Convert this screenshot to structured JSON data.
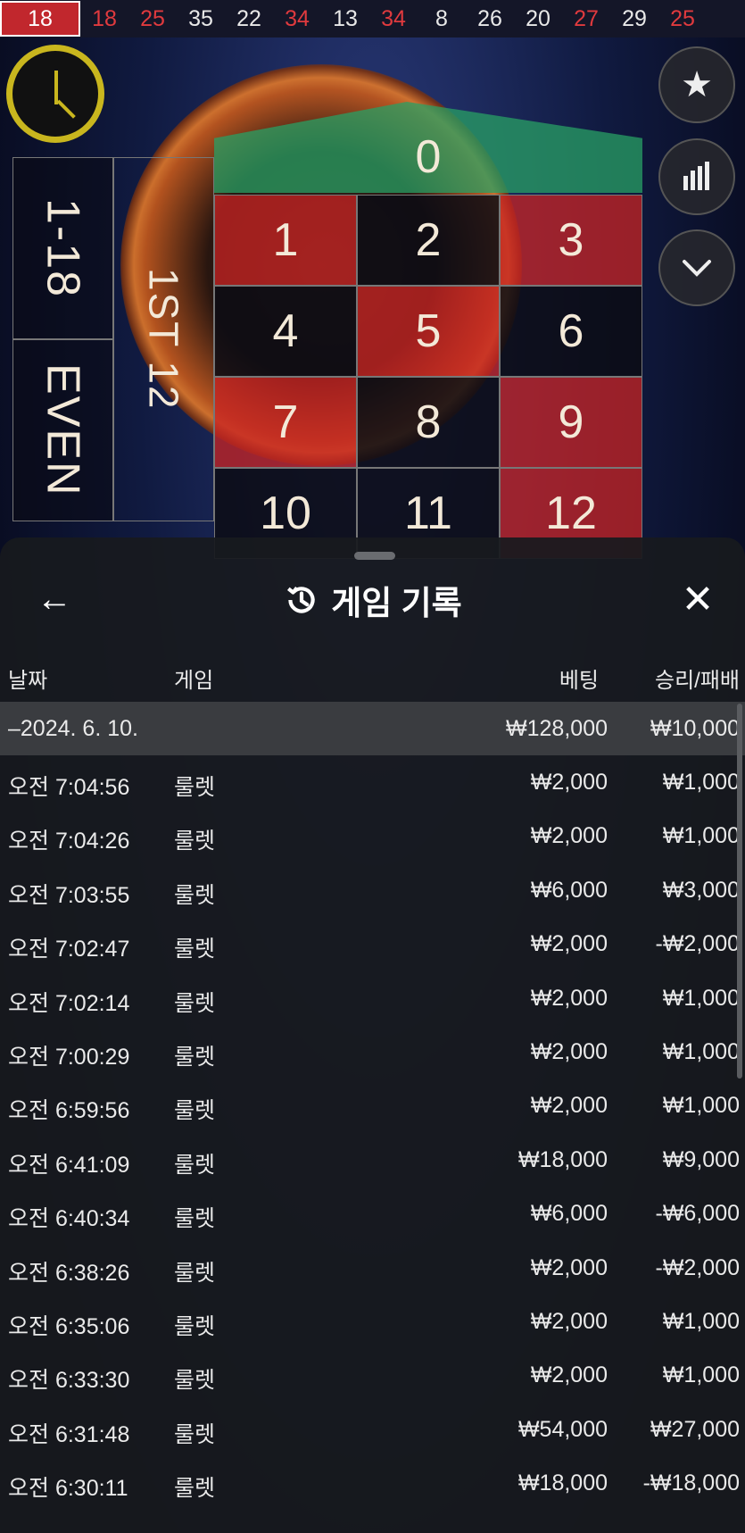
{
  "history": [
    "18",
    "18",
    "25",
    "35",
    "22",
    "34",
    "13",
    "34",
    "8",
    "26",
    "20",
    "27",
    "29",
    "25"
  ],
  "history_colors": [
    "red",
    "red",
    "red",
    "black",
    "black",
    "red",
    "black",
    "red",
    "black",
    "black",
    "black",
    "red",
    "black",
    "red"
  ],
  "table": {
    "zero": "0",
    "numbers": [
      [
        "1",
        "2",
        "3"
      ],
      [
        "4",
        "5",
        "6"
      ],
      [
        "7",
        "8",
        "9"
      ],
      [
        "10",
        "11",
        "12"
      ]
    ],
    "colors": [
      [
        "red",
        "black",
        "red"
      ],
      [
        "black",
        "red",
        "black"
      ],
      [
        "red",
        "black",
        "red"
      ],
      [
        "black",
        "black",
        "red"
      ]
    ],
    "outside_1_18": "1-18",
    "outside_even": "EVEN",
    "dozen_1st": "1ST 12"
  },
  "side_buttons": {
    "favorite_icon": "star-icon",
    "stats_icon": "bar-chart-icon",
    "collapse_icon": "chevron-down-icon"
  },
  "sheet": {
    "title": "게임 기록",
    "back_icon": "arrow-left-icon",
    "history_icon": "history-icon",
    "close_icon": "close-icon",
    "columns": {
      "date": "날짜",
      "game": "게임",
      "bet": "베팅",
      "result": "승리/패배"
    },
    "summary": {
      "date": "–2024. 6. 10.",
      "bet": "₩128,000",
      "result": "₩10,000"
    },
    "rows": [
      {
        "time": "오전 7:04:56",
        "game": "룰렛",
        "bet": "₩2,000",
        "result": "₩1,000"
      },
      {
        "time": "오전 7:04:26",
        "game": "룰렛",
        "bet": "₩2,000",
        "result": "₩1,000"
      },
      {
        "time": "오전 7:03:55",
        "game": "룰렛",
        "bet": "₩6,000",
        "result": "₩3,000"
      },
      {
        "time": "오전 7:02:47",
        "game": "룰렛",
        "bet": "₩2,000",
        "result": "-₩2,000"
      },
      {
        "time": "오전 7:02:14",
        "game": "룰렛",
        "bet": "₩2,000",
        "result": "₩1,000"
      },
      {
        "time": "오전 7:00:29",
        "game": "룰렛",
        "bet": "₩2,000",
        "result": "₩1,000"
      },
      {
        "time": "오전 6:59:56",
        "game": "룰렛",
        "bet": "₩2,000",
        "result": "₩1,000"
      },
      {
        "time": "오전 6:41:09",
        "game": "룰렛",
        "bet": "₩18,000",
        "result": "₩9,000"
      },
      {
        "time": "오전 6:40:34",
        "game": "룰렛",
        "bet": "₩6,000",
        "result": "-₩6,000"
      },
      {
        "time": "오전 6:38:26",
        "game": "룰렛",
        "bet": "₩2,000",
        "result": "-₩2,000"
      },
      {
        "time": "오전 6:35:06",
        "game": "룰렛",
        "bet": "₩2,000",
        "result": "₩1,000"
      },
      {
        "time": "오전 6:33:30",
        "game": "룰렛",
        "bet": "₩2,000",
        "result": "₩1,000"
      },
      {
        "time": "오전 6:31:48",
        "game": "룰렛",
        "bet": "₩54,000",
        "result": "₩27,000"
      },
      {
        "time": "오전 6:30:11",
        "game": "룰렛",
        "bet": "₩18,000",
        "result": "-₩18,000"
      }
    ]
  }
}
